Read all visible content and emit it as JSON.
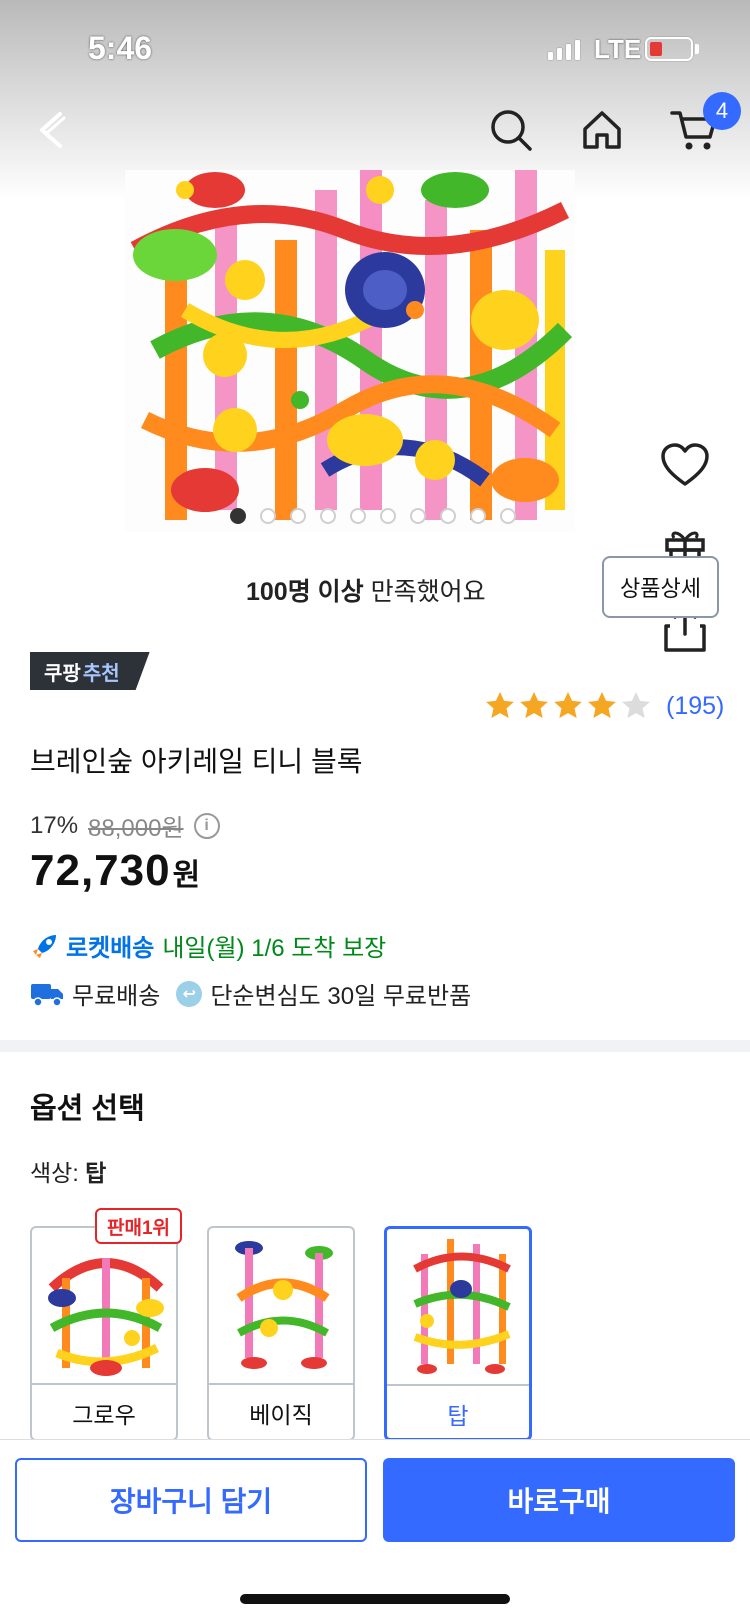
{
  "status": {
    "time": "5:46",
    "network": "LTE",
    "battery_level": 0.25
  },
  "header": {
    "cart_count": "4"
  },
  "gallery": {
    "dot_count": 10,
    "active_index": 0
  },
  "satisfaction": {
    "bold": "100명 이상",
    "rest": "만족했어요",
    "detail_button": "상품상세"
  },
  "badge": {
    "part1": "쿠팡",
    "part2": "추천"
  },
  "rating": {
    "stars": 4,
    "max": 5,
    "count": "(195)"
  },
  "product": {
    "title": "브레인숲 아키레일 티니 블록",
    "discount": "17%",
    "original_price": "88,000원",
    "sale_price": "72,730",
    "sale_unit": "원"
  },
  "delivery": {
    "rocket_brand": "로켓배송",
    "rocket_text": "내일(월) 1/6 도착 보장",
    "free_shipping": "무료배송",
    "free_return": "단순변심도 30일 무료반품"
  },
  "options": {
    "title": "옵션 선택",
    "color_label": "색상: ",
    "color_value": "탑",
    "best_badge": "판매1위",
    "items": [
      {
        "name": "그로우"
      },
      {
        "name": "베이직"
      },
      {
        "name": "탑"
      }
    ],
    "selected_index": 2
  },
  "actions": {
    "cart": "장바구니 담기",
    "buy": "바로구매"
  },
  "colors": {
    "accent": "#346aff",
    "rocket_blue": "#0073e9",
    "green": "#00891a",
    "star": "#f5a623",
    "badge_red": "#e52528"
  }
}
